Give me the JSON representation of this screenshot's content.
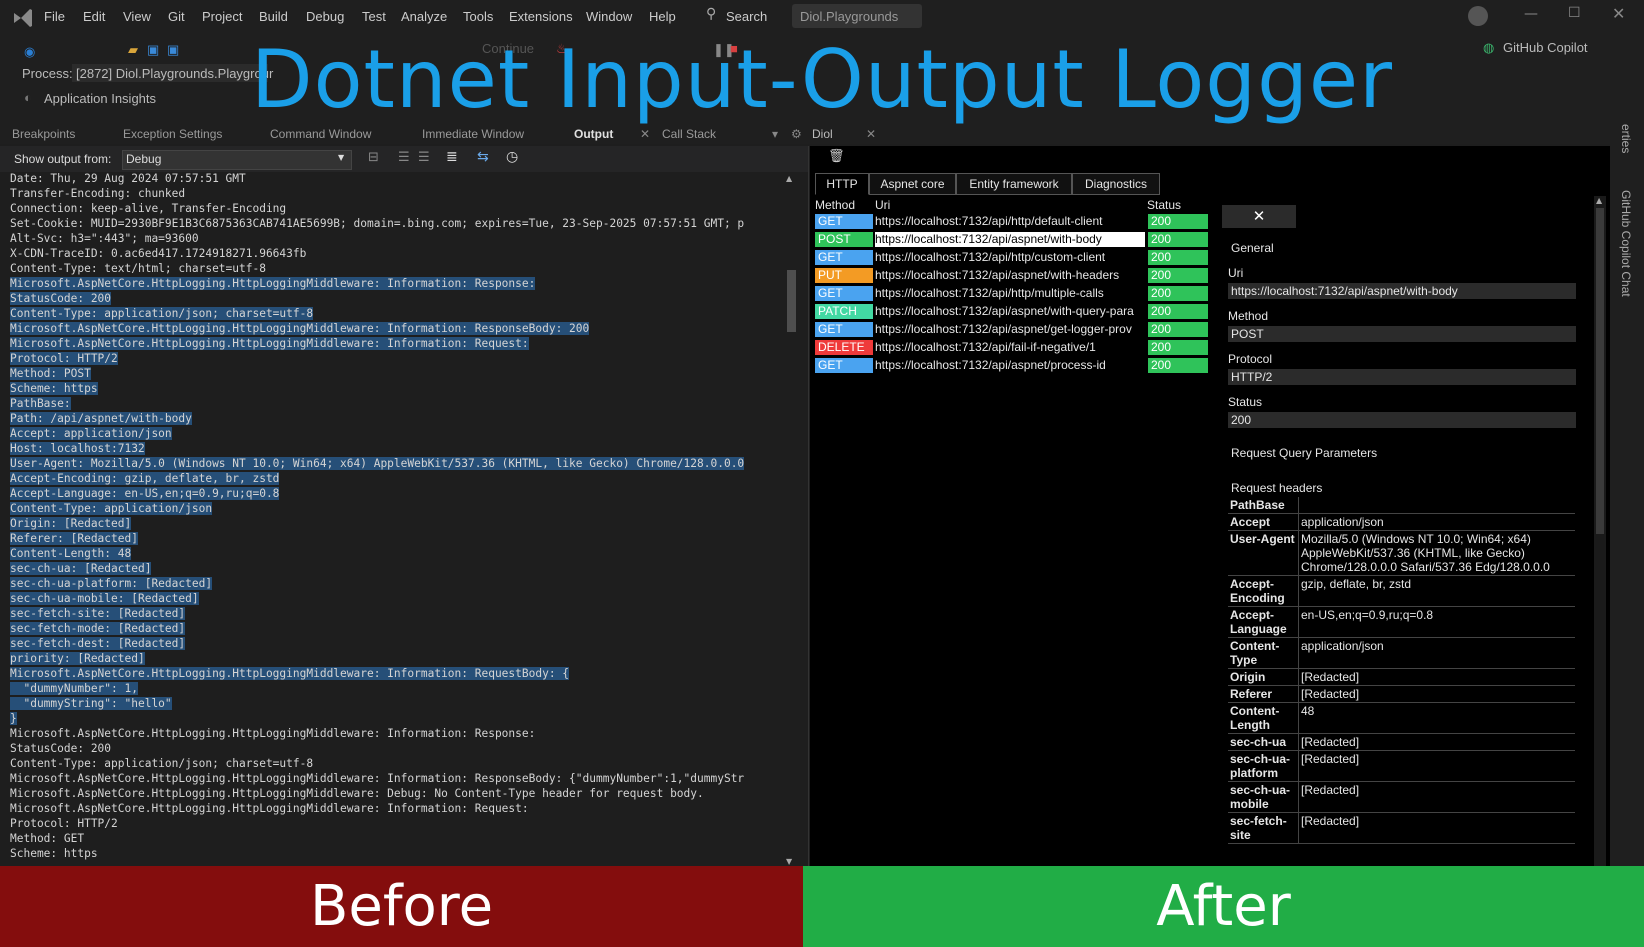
{
  "title": "Dotnet Input-Output Logger",
  "menu": [
    "File",
    "Edit",
    "View",
    "Git",
    "Project",
    "Build",
    "Debug",
    "Test",
    "Analyze",
    "Tools",
    "Extensions",
    "Window",
    "Help"
  ],
  "search_label": "Search",
  "solution_name": "Diol.Playgrounds",
  "toolbar": {
    "continue": "Continue",
    "process_label": "Process:",
    "process_value": "[2872] Diol.Playgrounds.Playgrour",
    "app_insights": "Application Insights",
    "copilot": "GitHub Copilot"
  },
  "bottom_tabs": [
    "Breakpoints",
    "Exception Settings",
    "Command Window",
    "Immediate Window",
    "Output",
    "Call Stack"
  ],
  "right_tab_title": "Diol",
  "output": {
    "show_from_label": "Show output from:",
    "source": "Debug"
  },
  "log_lines": [
    {
      "text": "Date: Thu, 29 Aug 2024 07:57:51 GMT",
      "hl": false
    },
    {
      "text": "Transfer-Encoding: chunked",
      "hl": false
    },
    {
      "text": "Connection: keep-alive, Transfer-Encoding",
      "hl": false
    },
    {
      "text": "Set-Cookie: MUID=2930BF9E1B3C6875363CAB741AE5699B; domain=.bing.com; expires=Tue, 23-Sep-2025 07:57:51 GMT; p",
      "hl": false
    },
    {
      "text": "Alt-Svc: h3=\":443\"; ma=93600",
      "hl": false
    },
    {
      "text": "X-CDN-TraceID: 0.ac6ed417.1724918271.96643fb",
      "hl": false
    },
    {
      "text": "Content-Type: text/html; charset=utf-8",
      "hl": false
    },
    {
      "text": "",
      "hl": false
    },
    {
      "text": "Microsoft.AspNetCore.HttpLogging.HttpLoggingMiddleware: Information: Response:",
      "hl": true
    },
    {
      "text": "StatusCode: 200",
      "hl": true
    },
    {
      "text": "Content-Type: application/json; charset=utf-8",
      "hl": true
    },
    {
      "text": "Microsoft.AspNetCore.HttpLogging.HttpLoggingMiddleware: Information: ResponseBody: 200",
      "hl": true
    },
    {
      "text": "Microsoft.AspNetCore.HttpLogging.HttpLoggingMiddleware: Information: Request:",
      "hl": true
    },
    {
      "text": "Protocol: HTTP/2",
      "hl": true
    },
    {
      "text": "Method: POST",
      "hl": true
    },
    {
      "text": "Scheme: https",
      "hl": true
    },
    {
      "text": "PathBase:",
      "hl": true
    },
    {
      "text": "Path: /api/aspnet/with-body",
      "hl": true
    },
    {
      "text": "Accept: application/json",
      "hl": true
    },
    {
      "text": "Host: localhost:7132",
      "hl": true
    },
    {
      "text": "User-Agent: Mozilla/5.0 (Windows NT 10.0; Win64; x64) AppleWebKit/537.36 (KHTML, like Gecko) Chrome/128.0.0.0",
      "hl": true
    },
    {
      "text": "Accept-Encoding: gzip, deflate, br, zstd",
      "hl": true
    },
    {
      "text": "Accept-Language: en-US,en;q=0.9,ru;q=0.8",
      "hl": true
    },
    {
      "text": "Content-Type: application/json",
      "hl": true
    },
    {
      "text": "Origin: [Redacted]",
      "hl": true
    },
    {
      "text": "Referer: [Redacted]",
      "hl": true
    },
    {
      "text": "Content-Length: 48",
      "hl": true
    },
    {
      "text": "sec-ch-ua: [Redacted]",
      "hl": true
    },
    {
      "text": "sec-ch-ua-platform: [Redacted]",
      "hl": true
    },
    {
      "text": "sec-ch-ua-mobile: [Redacted]",
      "hl": true
    },
    {
      "text": "sec-fetch-site: [Redacted]",
      "hl": true
    },
    {
      "text": "sec-fetch-mode: [Redacted]",
      "hl": true
    },
    {
      "text": "sec-fetch-dest: [Redacted]",
      "hl": true
    },
    {
      "text": "priority: [Redacted]",
      "hl": true
    },
    {
      "text": "Microsoft.AspNetCore.HttpLogging.HttpLoggingMiddleware: Information: RequestBody: {",
      "hl": true
    },
    {
      "text": "  \"dummyNumber\": 1,",
      "hl": true
    },
    {
      "text": "  \"dummyString\": \"hello\"",
      "hl": true
    },
    {
      "text": "}",
      "hl": true
    },
    {
      "text": "Microsoft.AspNetCore.HttpLogging.HttpLoggingMiddleware: Information: Response:",
      "hl": false
    },
    {
      "text": "StatusCode: 200",
      "hl": false
    },
    {
      "text": "Content-Type: application/json; charset=utf-8",
      "hl": false
    },
    {
      "text": "Microsoft.AspNetCore.HttpLogging.HttpLoggingMiddleware: Information: ResponseBody: {\"dummyNumber\":1,\"dummyStr",
      "hl": false
    },
    {
      "text": "Microsoft.AspNetCore.HttpLogging.HttpLoggingMiddleware: Debug: No Content-Type header for request body.",
      "hl": false
    },
    {
      "text": "Microsoft.AspNetCore.HttpLogging.HttpLoggingMiddleware: Information: Request:",
      "hl": false
    },
    {
      "text": "Protocol: HTTP/2",
      "hl": false
    },
    {
      "text": "Method: GET",
      "hl": false
    },
    {
      "text": "Scheme: https",
      "hl": false
    }
  ],
  "diol": {
    "tabs": [
      "HTTP",
      "Aspnet core",
      "Entity framework",
      "Diagnostics"
    ],
    "columns": {
      "method": "Method",
      "uri": "Uri",
      "status": "Status"
    },
    "requests": [
      {
        "method": "GET",
        "uri": "https://localhost:7132/api/http/default-client",
        "status": "200",
        "color": "#4aa3f0"
      },
      {
        "method": "POST",
        "uri": "https://localhost:7132/api/aspnet/with-body",
        "status": "200",
        "color": "#2fc35a",
        "selected": true
      },
      {
        "method": "GET",
        "uri": "https://localhost:7132/api/http/custom-client",
        "status": "200",
        "color": "#4aa3f0"
      },
      {
        "method": "PUT",
        "uri": "https://localhost:7132/api/aspnet/with-headers",
        "status": "200",
        "color": "#f39b24"
      },
      {
        "method": "GET",
        "uri": "https://localhost:7132/api/http/multiple-calls",
        "status": "200",
        "color": "#4aa3f0"
      },
      {
        "method": "PATCH",
        "uri": "https://localhost:7132/api/aspnet/with-query-para",
        "status": "200",
        "color": "#42d9a3"
      },
      {
        "method": "GET",
        "uri": "https://localhost:7132/api/aspnet/get-logger-prov",
        "status": "200",
        "color": "#4aa3f0"
      },
      {
        "method": "DELETE",
        "uri": "https://localhost:7132/api/fail-if-negative/1",
        "status": "200",
        "color": "#ef3a3a"
      },
      {
        "method": "GET",
        "uri": "https://localhost:7132/api/aspnet/process-id",
        "status": "200",
        "color": "#4aa3f0"
      }
    ],
    "status_color": "#2fc35a",
    "detail": {
      "close": "✕",
      "general": "General",
      "uri_label": "Uri",
      "uri_value": "https://localhost:7132/api/aspnet/with-body",
      "method_label": "Method",
      "method_value": "POST",
      "protocol_label": "Protocol",
      "protocol_value": "HTTP/2",
      "status_label": "Status",
      "status_value": "200",
      "query_label": "Request Query Parameters",
      "headers_label": "Request headers",
      "headers": [
        {
          "k": "PathBase",
          "v": ""
        },
        {
          "k": "Accept",
          "v": "application/json"
        },
        {
          "k": "User-Agent",
          "v": "Mozilla/5.0 (Windows NT 10.0; Win64; x64) AppleWebKit/537.36 (KHTML, like Gecko) Chrome/128.0.0.0 Safari/537.36 Edg/128.0.0.0"
        },
        {
          "k": "Accept-Encoding",
          "v": "gzip, deflate, br, zstd"
        },
        {
          "k": "Accept-Language",
          "v": "en-US,en;q=0.9,ru;q=0.8"
        },
        {
          "k": "Content-Type",
          "v": "application/json"
        },
        {
          "k": "Origin",
          "v": "[Redacted]"
        },
        {
          "k": "Referer",
          "v": "[Redacted]"
        },
        {
          "k": "Content-Length",
          "v": "48"
        },
        {
          "k": "sec-ch-ua",
          "v": "[Redacted]"
        },
        {
          "k": "sec-ch-ua-platform",
          "v": "[Redacted]"
        },
        {
          "k": "sec-ch-ua-mobile",
          "v": "[Redacted]"
        },
        {
          "k": "sec-fetch-site",
          "v": "[Redacted]"
        }
      ]
    }
  },
  "side_labels": [
    "erties",
    "GitHub Copilot Chat"
  ],
  "before_label": "Before",
  "after_label": "After"
}
